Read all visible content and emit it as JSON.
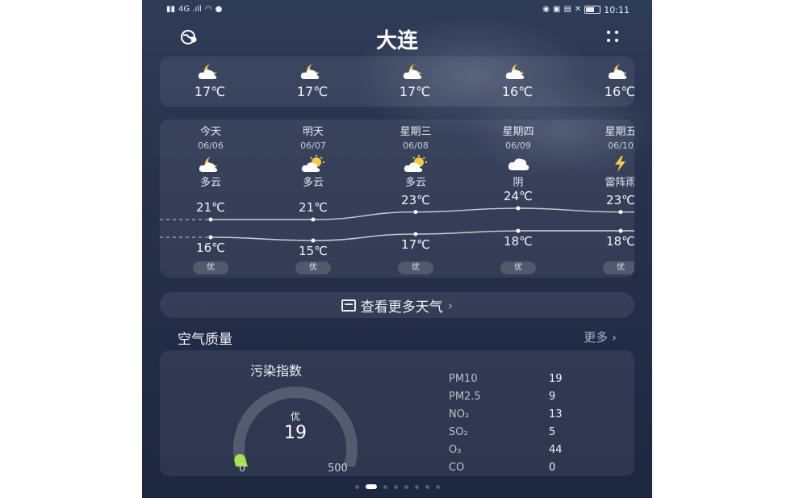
{
  "status_bar": {
    "left": "4G .ıll",
    "time": "10:11"
  },
  "header": {
    "city": "大连"
  },
  "hourly": [
    {
      "temp": "17℃",
      "icon": "partly-cloudy-night-icon"
    },
    {
      "temp": "17℃",
      "icon": "partly-cloudy-night-icon"
    },
    {
      "temp": "17℃",
      "icon": "partly-cloudy-night-icon"
    },
    {
      "temp": "16℃",
      "icon": "partly-cloudy-night-icon"
    },
    {
      "temp": "16℃",
      "icon": "partly-cloudy-night-icon"
    }
  ],
  "daily": [
    {
      "day": "今天",
      "date": "06/06",
      "cond": "多云",
      "hi": "21℃",
      "lo": "16℃",
      "hi_v": 21,
      "lo_v": 16,
      "aqi": "优",
      "icon": "partly-cloudy-night-icon"
    },
    {
      "day": "明天",
      "date": "06/07",
      "cond": "多云",
      "hi": "21℃",
      "lo": "15℃",
      "hi_v": 21,
      "lo_v": 15,
      "aqi": "优",
      "icon": "partly-cloudy-day-icon"
    },
    {
      "day": "星期三",
      "date": "06/08",
      "cond": "多云",
      "hi": "23℃",
      "lo": "17℃",
      "hi_v": 23,
      "lo_v": 17,
      "aqi": "优",
      "icon": "partly-cloudy-day-icon"
    },
    {
      "day": "星期四",
      "date": "06/09",
      "cond": "阴",
      "hi": "24℃",
      "lo": "18℃",
      "hi_v": 24,
      "lo_v": 18,
      "aqi": "优",
      "icon": "cloudy-icon"
    },
    {
      "day": "星期五",
      "date": "06/10",
      "cond": "雷阵雨",
      "hi": "23℃",
      "lo": "18℃",
      "hi_v": 23,
      "lo_v": 18,
      "aqi": "优",
      "icon": "thunderstorm-icon"
    }
  ],
  "more_weather": {
    "label": "查看更多天气"
  },
  "air_quality": {
    "title": "空气质量",
    "more": "更多",
    "index_label": "污染指数",
    "quality": "优",
    "value": "19",
    "value_v": 19,
    "min": "0",
    "max": "500",
    "pollutants": [
      {
        "name": "PM10",
        "value": "19"
      },
      {
        "name": "PM2.5",
        "value": "9"
      },
      {
        "name": "NO₂",
        "value": "13"
      },
      {
        "name": "SO₂",
        "value": "5"
      },
      {
        "name": "O₃",
        "value": "44"
      },
      {
        "name": "CO",
        "value": "0"
      }
    ]
  },
  "pager": {
    "count": 8,
    "active": 1
  },
  "colors": {
    "gauge_good": "#a8e04f",
    "card_bg": "#2a3550",
    "accent_sun": "#f7c948"
  }
}
